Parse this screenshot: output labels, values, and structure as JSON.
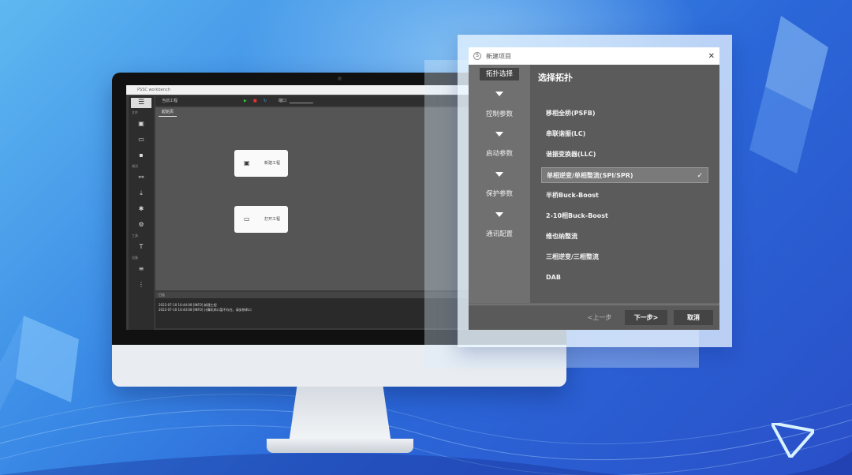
{
  "app": {
    "title": "PSSC workbench",
    "toolbar_label": "当前工程",
    "port_label": "端口",
    "tab_start": "起始页",
    "sidebar_labels": [
      "文件",
      "调试",
      "工具",
      "设备"
    ],
    "card_new": "新建工程",
    "card_open": "打开工程",
    "log_title": "日志",
    "log_lines": [
      "2022-07-10 16:44:08 [INFO] 新建工程",
      "2022-07-10 16:44:08 [INFO] 计算机串口暂不存在，请安装串口"
    ]
  },
  "dialog": {
    "title": "新建项目",
    "heading": "选择拓扑",
    "nav": [
      "拓扑选择",
      "控制参数",
      "启动参数",
      "保护参数",
      "通讯配置"
    ],
    "options": [
      "移相全桥(PSFB)",
      "串联谐振(LC)",
      "谐振变换器(LLC)",
      "单相逆变/单相整流(SPI/SPR)",
      "半桥Buck-Boost",
      "2-10相Buck-Boost",
      "维也纳整流",
      "三相逆变/三相整流",
      "DAB"
    ],
    "selected_index": 3,
    "buttons": {
      "prev": "<上一步",
      "next": "下一步>",
      "cancel": "取消"
    }
  },
  "colors": {
    "bg_top": "#5fb8f0",
    "bg_bottom": "#2a4fc8",
    "dialog_bg": "#5b5b5b"
  }
}
